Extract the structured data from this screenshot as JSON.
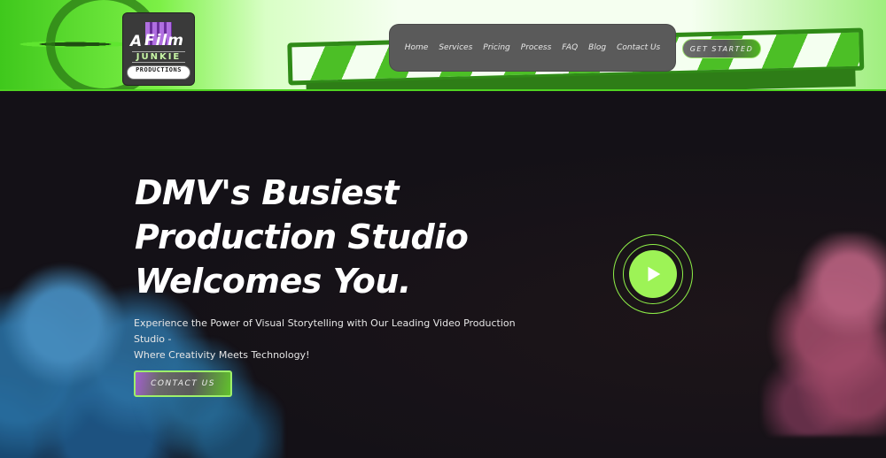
{
  "logo": {
    "line1_a": "A",
    "line1_film": "Film",
    "line2": "JUNKIE",
    "line3": "PRODUCTIONS"
  },
  "nav": {
    "items": [
      "Home",
      "Services",
      "Pricing",
      "Process",
      "FAQ",
      "Blog",
      "Contact Us"
    ]
  },
  "header": {
    "cta_label": "GET STARTED"
  },
  "hero": {
    "title_line1": "DMV's Busiest",
    "title_line2": "Production Studio",
    "title_line3": "Welcomes You.",
    "subtitle_line1": "Experience the Power of Visual Storytelling with Our Leading Video Production Studio -",
    "subtitle_line2": "Where Creativity Meets Technology!",
    "contact_label": "CONTACT US"
  },
  "colors": {
    "accent_green": "#9df356",
    "background": "#141117",
    "nav_bg": "#5a5a5a",
    "accent_purple": "#a35fd0"
  },
  "icons": {
    "play": "play-icon"
  }
}
